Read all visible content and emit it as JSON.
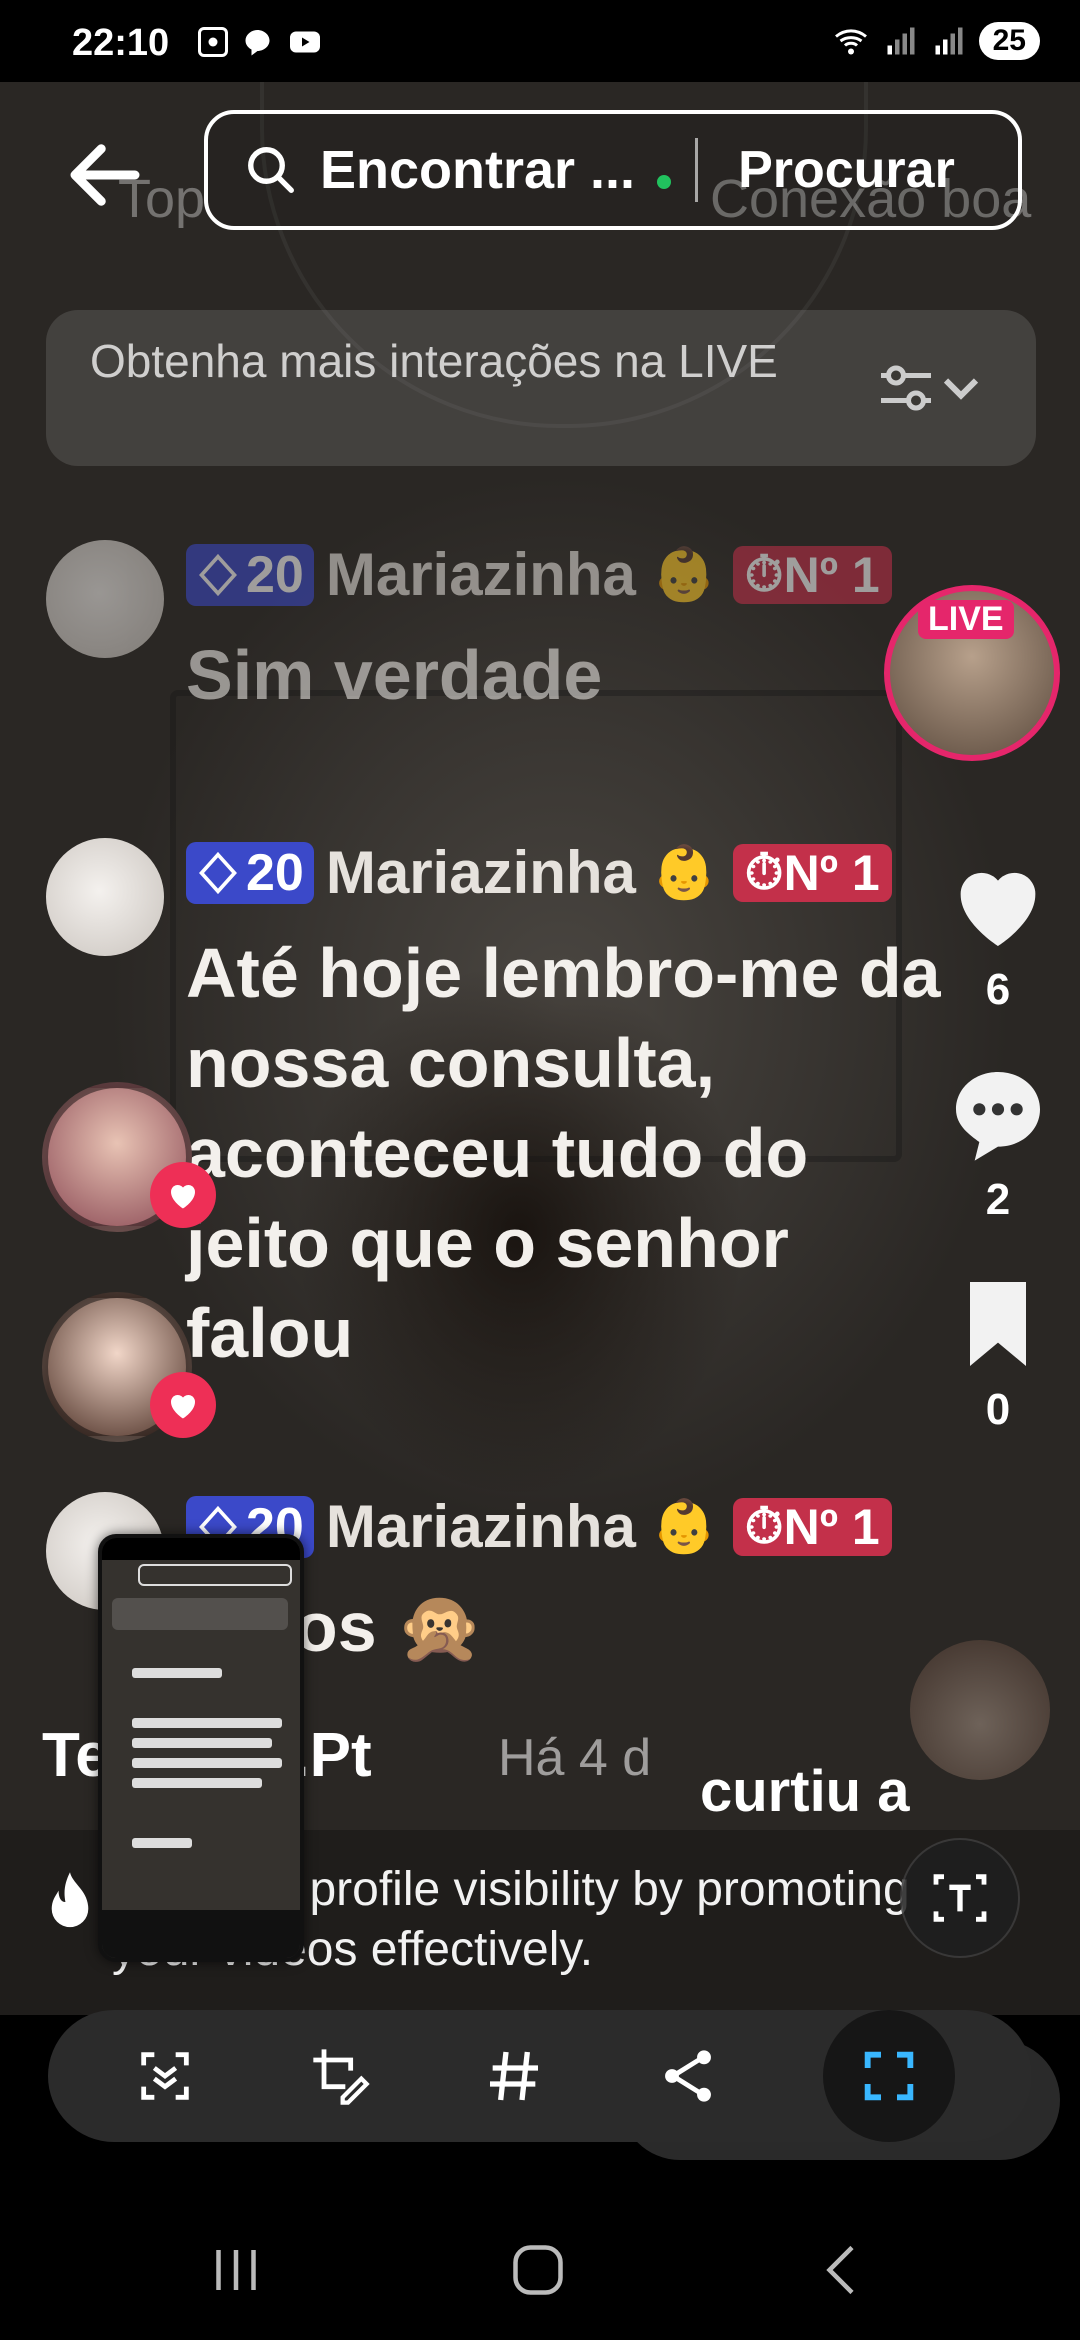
{
  "status_bar": {
    "time": "22:10",
    "battery": "25"
  },
  "header": {
    "search_placeholder": "Encontrar ...",
    "search_button": "Procurar",
    "ghost_left": "Top",
    "ghost_right": "Conexão boa"
  },
  "banner": {
    "text": "Obtenha mais interações na LIVE"
  },
  "comments": [
    {
      "level": "20",
      "username": "Mariazinha",
      "badge": "👶",
      "rank": "Nº 1",
      "text": "Sim verdade"
    },
    {
      "level": "20",
      "username": "Mariazinha",
      "badge": "👶",
      "rank": "Nº 1",
      "text": "Até hoje lembro-me da nossa consulta, aconteceu tudo do jeito que o senhor falou"
    },
    {
      "level": "20",
      "username": "Mariazinha",
      "badge": "👶",
      "rank": "Nº 1",
      "text": "Risos 🙊"
    }
  ],
  "live_badge": "LIVE",
  "actions": {
    "likes": "6",
    "comments": "2",
    "saves": "0"
  },
  "post": {
    "author": "Terapias.Pt",
    "time_ago": "Há 4 d",
    "liked_text": "curtiu a"
  },
  "promo": {
    "text": "Increase profile visibility by promoting your videos effectively."
  },
  "icons": {
    "back": "arrow-left-icon",
    "search": "search-icon",
    "filter": "sliders-icon",
    "heart": "heart-icon",
    "comment": "comment-icon",
    "bookmark": "bookmark-icon",
    "text_recognition": "text-recognition-icon",
    "flame": "flame-icon"
  },
  "toolbar": [
    {
      "name": "scroll-capture",
      "icon": "scroll-capture-icon"
    },
    {
      "name": "edit",
      "icon": "crop-edit-icon"
    },
    {
      "name": "hashtag",
      "icon": "hashtag-icon"
    },
    {
      "name": "share",
      "icon": "share-icon"
    },
    {
      "name": "capture",
      "icon": "capture-frame-icon",
      "active": true
    }
  ],
  "colors": {
    "live": "#e5266b",
    "level": "#3b49c9",
    "rank": "#c3304a",
    "heart": "#ee2f56",
    "capture_accent": "#39b7ff"
  }
}
